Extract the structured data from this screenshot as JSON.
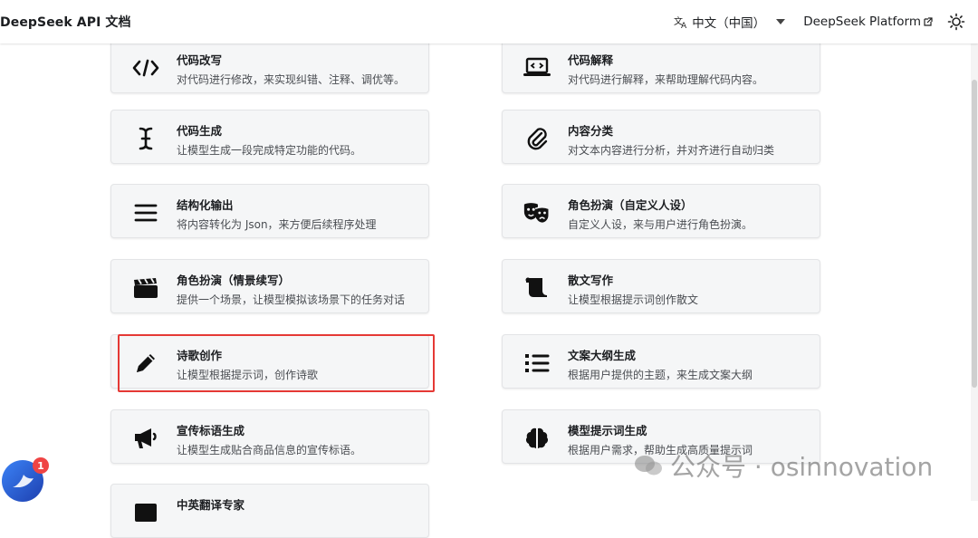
{
  "navbar": {
    "brand": "DeepSeek API 文档",
    "language_icon": "translate-icon",
    "language": "中文（中国）",
    "platform_link": "DeepSeek Platform",
    "theme_icon": "sun-icon"
  },
  "cards": [
    {
      "title": "代码改写",
      "desc": "对代码进行修改，来实现纠错、注释、调优等。",
      "icon": "code-icon"
    },
    {
      "title": "代码解释",
      "desc": "对代码进行解释，来帮助理解代码内容。",
      "icon": "laptop-code-icon"
    },
    {
      "title": "代码生成",
      "desc": "让模型生成一段完成特定功能的代码。",
      "icon": "text-cursor-icon"
    },
    {
      "title": "内容分类",
      "desc": "对文本内容进行分析，并对齐进行自动归类",
      "icon": "paperclip-icon"
    },
    {
      "title": "结构化输出",
      "desc": "将内容转化为 Json，来方便后续程序处理",
      "icon": "menu-lines-icon"
    },
    {
      "title": "角色扮演（自定义人设）",
      "desc": "自定义人设，来与用户进行角色扮演。",
      "icon": "theater-masks-icon"
    },
    {
      "title": "角色扮演（情景续写）",
      "desc": "提供一个场景，让模型模拟该场景下的任务对话",
      "icon": "clapperboard-icon"
    },
    {
      "title": "散文写作",
      "desc": "让模型根据提示词创作散文",
      "icon": "scroll-icon"
    },
    {
      "title": "诗歌创作",
      "desc": "让模型根据提示词，创作诗歌",
      "icon": "pencil-icon"
    },
    {
      "title": "文案大纲生成",
      "desc": "根据用户提供的主题，来生成文案大纲",
      "icon": "list-icon"
    },
    {
      "title": "宣传标语生成",
      "desc": "让模型生成贴合商品信息的宣传标语。",
      "icon": "megaphone-icon"
    },
    {
      "title": "模型提示词生成",
      "desc": "根据用户需求，帮助生成高质量提示词",
      "icon": "brain-icon"
    },
    {
      "title": "中英翻译专家",
      "desc": "",
      "icon": "language-icon"
    }
  ],
  "overlay": {
    "badge_count": "1",
    "watermark": "公众号 · osinnovation"
  }
}
